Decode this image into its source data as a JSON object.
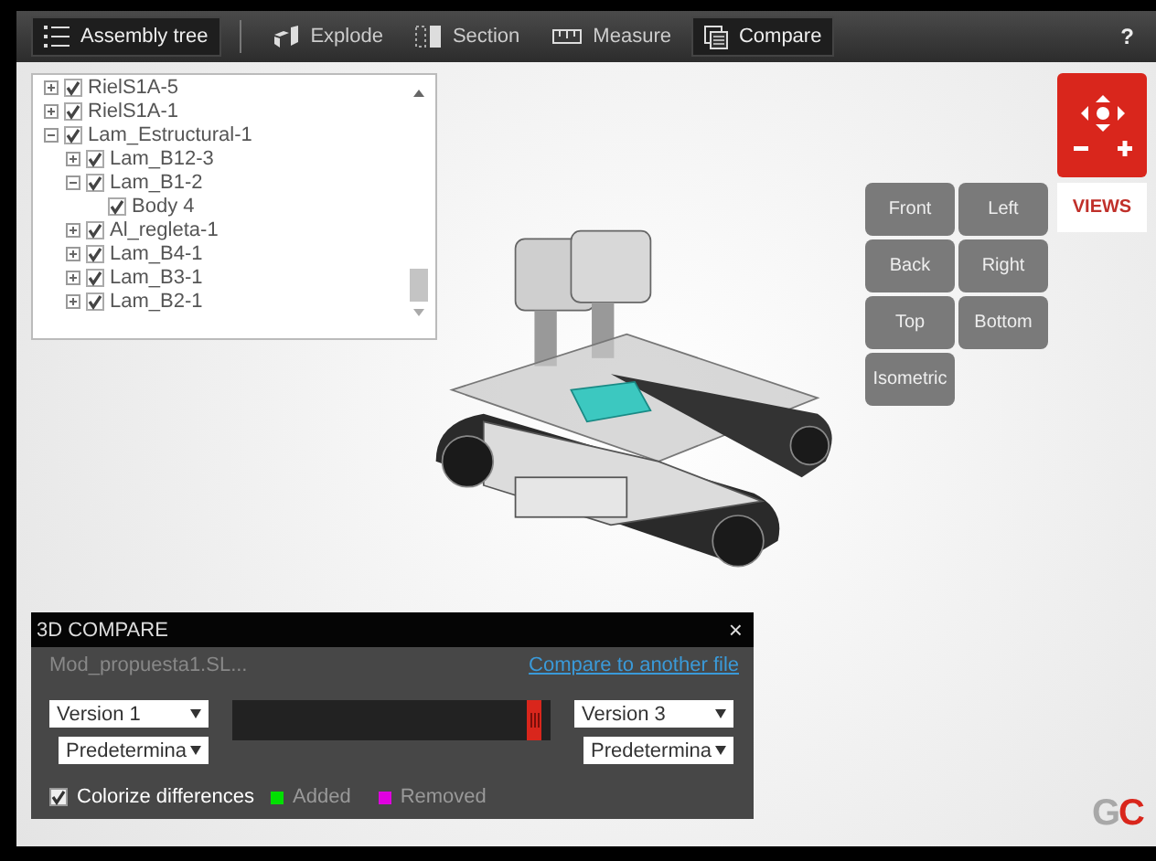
{
  "toolbar": {
    "items": [
      {
        "label": "Assembly tree",
        "selected": true
      },
      {
        "label": "Explode",
        "selected": false
      },
      {
        "label": "Section",
        "selected": false
      },
      {
        "label": "Measure",
        "selected": false
      },
      {
        "label": "Compare",
        "selected": true
      }
    ],
    "help": "?"
  },
  "tree": {
    "items": [
      {
        "label": "RielS1A-5",
        "checked": true,
        "expanded": false
      },
      {
        "label": "RielS1A-1",
        "checked": true,
        "expanded": false
      },
      {
        "label": "Lam_Estructural-1",
        "checked": true,
        "expanded": true,
        "children": [
          {
            "label": "Lam_B12-3",
            "checked": true,
            "expanded": false
          },
          {
            "label": "Lam_B1-2",
            "checked": true,
            "expanded": true,
            "children": [
              {
                "label": "Body 4",
                "checked": true
              }
            ]
          },
          {
            "label": "Al_regleta-1",
            "checked": true,
            "expanded": false
          },
          {
            "label": "Lam_B4-1",
            "checked": true,
            "expanded": false
          },
          {
            "label": "Lam_B3-1",
            "checked": true,
            "expanded": false
          },
          {
            "label": "Lam_B2-1",
            "checked": true,
            "expanded": false
          }
        ]
      }
    ]
  },
  "views": {
    "label": "VIEWS",
    "buttons": [
      "Front",
      "Left",
      "Back",
      "Right",
      "Top",
      "Bottom",
      "Isometric"
    ]
  },
  "compare": {
    "title": "3D COMPARE",
    "close": "×",
    "file": "Mod_propuesta1.SL...",
    "link": "Compare to another file",
    "left_version": "Version 1",
    "left_config": "Predetermina",
    "right_version": "Version 3",
    "right_config": "Predetermina",
    "slider": {
      "level": 0.97
    },
    "colorize": {
      "label": "Colorize differences",
      "checked": true
    },
    "legend": [
      {
        "label": "Added",
        "color": "#00e000"
      },
      {
        "label": "Removed",
        "color": "#e000e0"
      }
    ]
  },
  "logo": {
    "first": "G",
    "second": "C"
  }
}
